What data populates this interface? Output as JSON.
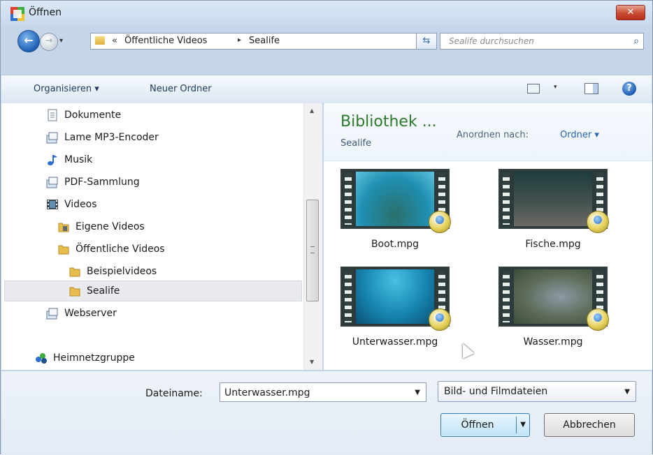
{
  "window": {
    "title": "Öffnen",
    "close_label": "✕"
  },
  "address": {
    "chevron": "«",
    "crumbs": [
      "Öffentliche Videos",
      "Sealife"
    ],
    "separator": "▸",
    "dropdown": "▾",
    "refresh": "⇆"
  },
  "search": {
    "placeholder": "Sealife durchsuchen",
    "icon": "⌕"
  },
  "toolbar": {
    "organize_label": "Organisieren ▾",
    "new_folder_label": "Neuer Ordner",
    "view_drop": "▾",
    "help": "?"
  },
  "nav": {
    "items": [
      {
        "label": "Dokumente",
        "icon": "document-icon"
      },
      {
        "label": "Lame MP3-Encoder",
        "icon": "library-icon"
      },
      {
        "label": "Musik",
        "icon": "music-note-icon"
      },
      {
        "label": "PDF-Sammlung",
        "icon": "library-icon"
      },
      {
        "label": "Videos",
        "icon": "film-icon"
      },
      {
        "label": "Eigene Videos",
        "icon": "folder-icon"
      },
      {
        "label": "Öffentliche Videos",
        "icon": "folder-icon"
      },
      {
        "label": "Beispielvideos",
        "icon": "folder-icon"
      },
      {
        "label": "Sealife",
        "icon": "folder-icon"
      },
      {
        "label": "Webserver",
        "icon": "library-icon"
      },
      {
        "label": "Heimnetzgruppe",
        "icon": "homegroup-icon"
      }
    ],
    "selected": "Sealife"
  },
  "content": {
    "title": "Bibliothek ...",
    "subtitle": "Sealife",
    "arrange_label": "Anordnen nach:",
    "arrange_value": "Ordner ▾",
    "files": [
      {
        "name": "Boot.mpg"
      },
      {
        "name": "Fische.mpg"
      },
      {
        "name": "Unterwasser.mpg"
      },
      {
        "name": "Wasser.mpg"
      }
    ]
  },
  "footer": {
    "filename_label": "Dateiname:",
    "filename_value": "Unterwasser.mpg",
    "filter_value": "Bild- und Filmdateien",
    "open_label": "Öffnen",
    "cancel_label": "Abbrechen"
  },
  "colors": {
    "accent": "#2a62b4",
    "library_title": "#2c7a2a",
    "frame_bg": "#c5d6ea"
  }
}
